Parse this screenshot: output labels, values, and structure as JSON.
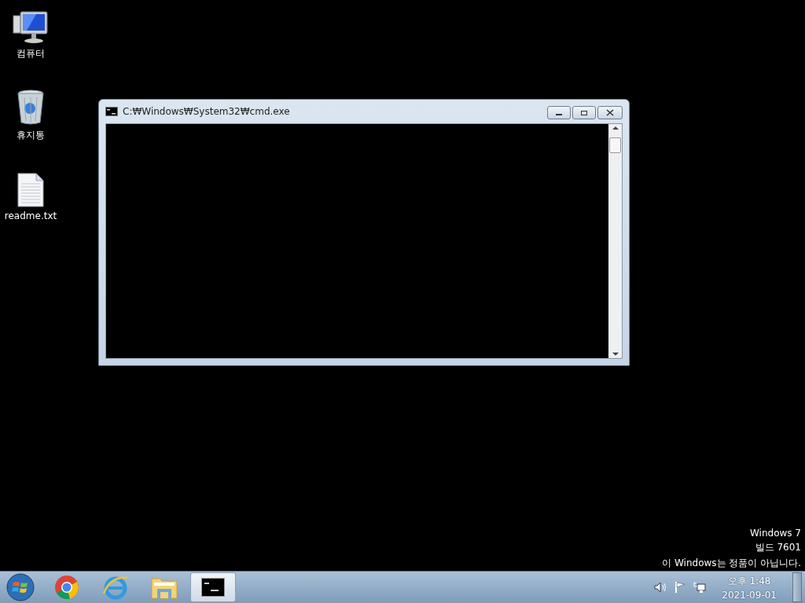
{
  "desktop_icons": [
    {
      "kind": "computer",
      "label": "컴퓨터"
    },
    {
      "kind": "recycle-bin",
      "label": "휴지통"
    },
    {
      "kind": "text-file",
      "label": "readme.txt"
    }
  ],
  "window": {
    "title": "C:₩Windows₩System32₩cmd.exe"
  },
  "watermark_notice": [
    "Windows 7",
    "빌드 7601",
    "이 Windows는 정품이 아닙니다."
  ],
  "taskbar": {
    "items": [
      {
        "kind": "start",
        "selected": false
      },
      {
        "kind": "chrome",
        "selected": false
      },
      {
        "kind": "ie",
        "selected": false
      },
      {
        "kind": "folder",
        "selected": false
      },
      {
        "kind": "console",
        "selected": true
      }
    ],
    "tray": {
      "time": "오후 1:48",
      "date": "2021-09-01"
    }
  }
}
